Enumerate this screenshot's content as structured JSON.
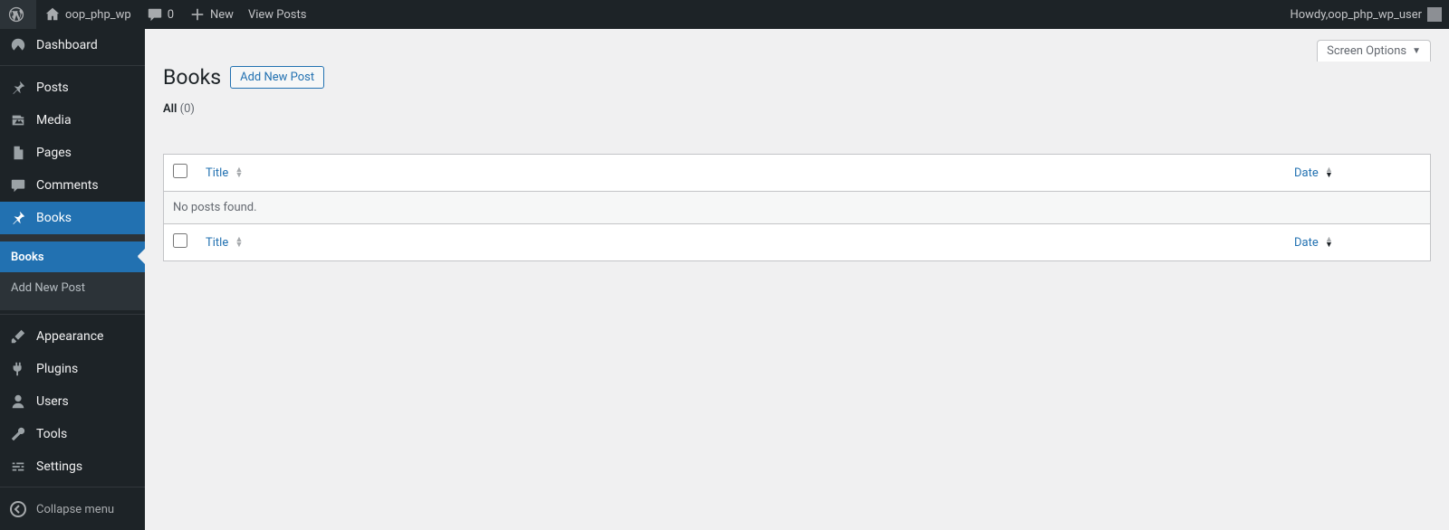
{
  "adminbar": {
    "site_name": "oop_php_wp",
    "comments_count": "0",
    "new_label": "New",
    "view_posts_label": "View Posts",
    "howdy_prefix": "Howdy, ",
    "user_display_name": "oop_php_wp_user"
  },
  "sidebar": {
    "items": [
      {
        "id": "dashboard",
        "label": "Dashboard",
        "icon": "dashboard-icon"
      },
      {
        "id": "posts",
        "label": "Posts",
        "icon": "pin-icon"
      },
      {
        "id": "media",
        "label": "Media",
        "icon": "media-icon"
      },
      {
        "id": "pages",
        "label": "Pages",
        "icon": "page-icon"
      },
      {
        "id": "comments",
        "label": "Comments",
        "icon": "comment-icon"
      },
      {
        "id": "books",
        "label": "Books",
        "icon": "pin-icon",
        "current": true
      },
      {
        "id": "appearance",
        "label": "Appearance",
        "icon": "brush-icon"
      },
      {
        "id": "plugins",
        "label": "Plugins",
        "icon": "plug-icon"
      },
      {
        "id": "users",
        "label": "Users",
        "icon": "user-icon"
      },
      {
        "id": "tools",
        "label": "Tools",
        "icon": "wrench-icon"
      },
      {
        "id": "settings",
        "label": "Settings",
        "icon": "sliders-icon"
      }
    ],
    "books_submenu": [
      {
        "id": "books-list",
        "label": "Books",
        "current": true
      },
      {
        "id": "books-add",
        "label": "Add New Post"
      }
    ],
    "collapse_label": "Collapse menu"
  },
  "screen_options_label": "Screen Options",
  "page": {
    "title": "Books",
    "add_new_label": "Add New Post",
    "filter": {
      "label": "All",
      "count": "(0)"
    },
    "columns": {
      "title": "Title",
      "date": "Date"
    },
    "empty_text": "No posts found."
  }
}
